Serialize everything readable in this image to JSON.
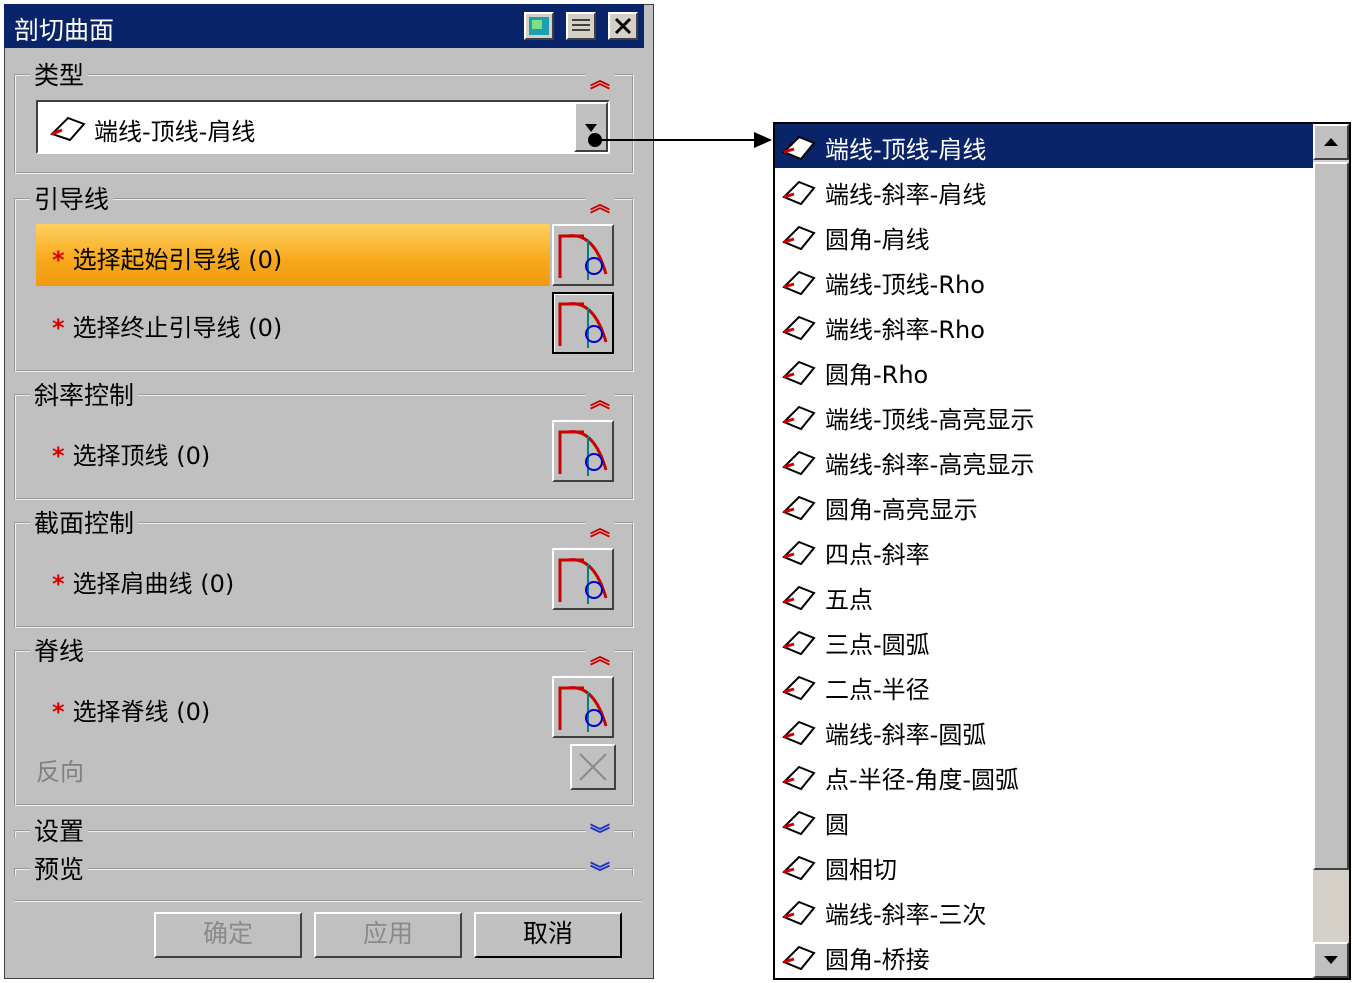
{
  "dialog": {
    "title": "剖切曲面",
    "type_section": {
      "label": "类型",
      "selected": "端线-顶线-肩线"
    },
    "guide_section": {
      "label": "引导线",
      "rows": [
        {
          "label": "选择起始引导线",
          "count": "(0)"
        },
        {
          "label": "选择终止引导线",
          "count": "(0)"
        }
      ]
    },
    "slope_section": {
      "label": "斜率控制",
      "row": {
        "label": "选择顶线",
        "count": "(0)"
      }
    },
    "section_control": {
      "label": "截面控制",
      "row": {
        "label": "选择肩曲线",
        "count": "(0)"
      }
    },
    "spine_section": {
      "label": "脊线",
      "row": {
        "label": "选择脊线",
        "count": "(0)"
      },
      "reverse_label": "反向"
    },
    "settings_label": "设置",
    "preview_label": "预览",
    "buttons": {
      "ok": "确定",
      "apply": "应用",
      "cancel": "取消"
    }
  },
  "dropdown": {
    "items": [
      "端线-顶线-肩线",
      "端线-斜率-肩线",
      "圆角-肩线",
      "端线-顶线-Rho",
      "端线-斜率-Rho",
      "圆角-Rho",
      "端线-顶线-高亮显示",
      "端线-斜率-高亮显示",
      "圆角-高亮显示",
      "四点-斜率",
      "五点",
      "三点-圆弧",
      "二点-半径",
      "端线-斜率-圆弧",
      "点-半径-角度-圆弧",
      "圆",
      "圆相切",
      "端线-斜率-三次",
      "圆角-桥接"
    ],
    "selected_index": 0
  },
  "colors": {
    "titlebar": "#0a246a",
    "highlight": "#f7a81a",
    "required_star": "#dd0000",
    "chevron": "#cc0000"
  }
}
